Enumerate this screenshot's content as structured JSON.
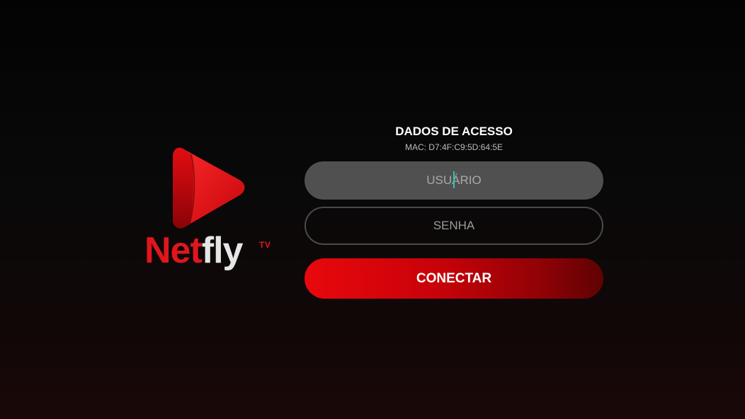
{
  "app": {
    "brand_primary": "Net",
    "brand_secondary": "fly",
    "brand_tv": "TV",
    "accent_color": "#e0161d"
  },
  "login": {
    "title": "DADOS DE ACESSO",
    "mac": "MAC: D7:4F:C9:5D:64:5E",
    "username_placeholder": "USUÁRIO",
    "password_placeholder": "SENHA",
    "connect_label": "CONECTAR"
  }
}
